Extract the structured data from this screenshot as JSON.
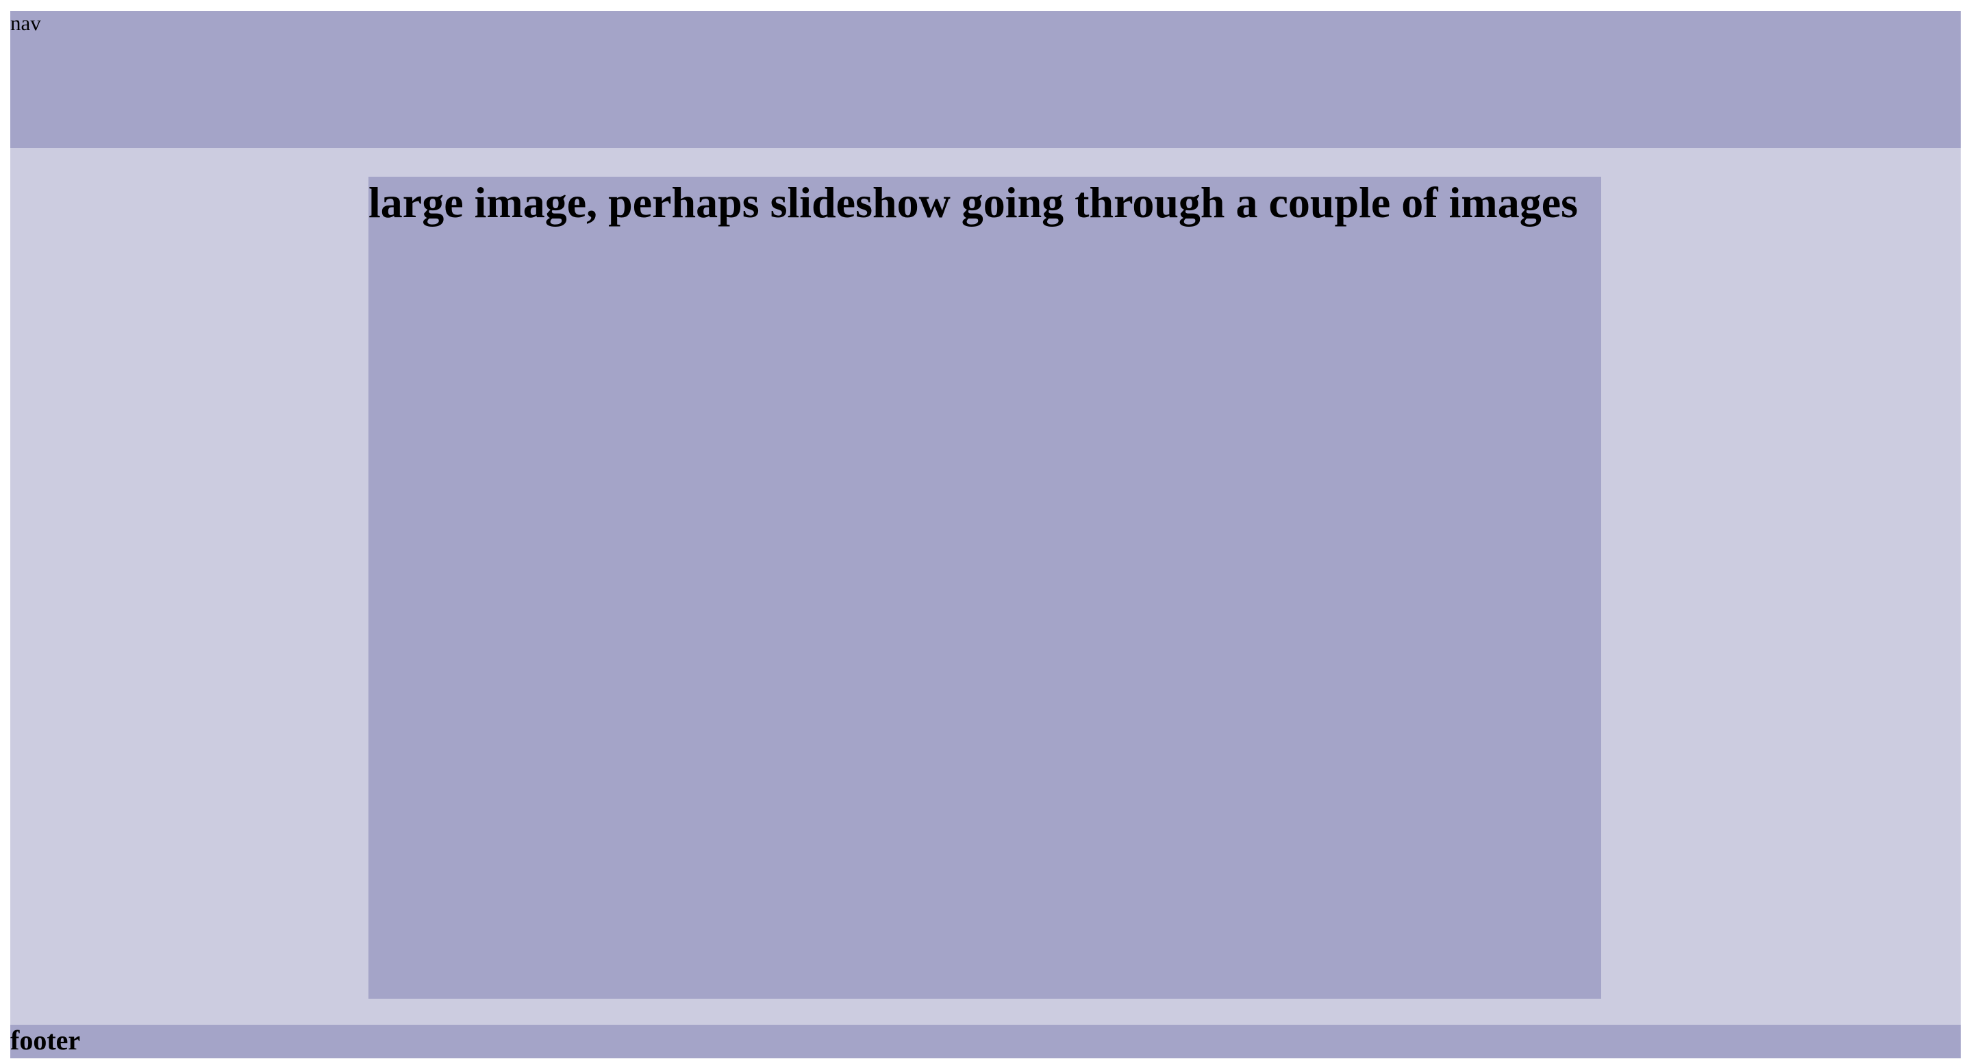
{
  "nav": {
    "label": "nav"
  },
  "main": {
    "hero_title": "large image, perhaps slideshow going through a couple of images"
  },
  "footer": {
    "label": "footer"
  },
  "colors": {
    "bar_background": "#a4a4c8",
    "main_background": "#ccccE0"
  }
}
